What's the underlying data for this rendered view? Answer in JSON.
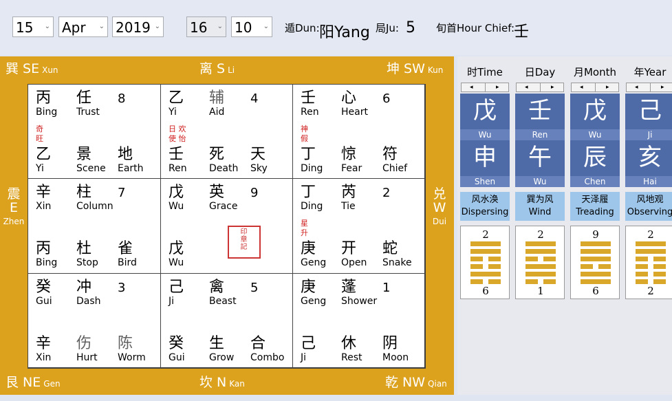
{
  "controls": {
    "day": "15",
    "month": "Apr",
    "year": "2019",
    "hour": "16",
    "minute": "10"
  },
  "info": {
    "dun_label": "遁Dun:",
    "dun_value": "阳Yang",
    "ju_label": "局Ju:",
    "ju_value": "5",
    "chief_label": "旬首Hour Chief:",
    "chief_value": "壬"
  },
  "directions": {
    "se": "巽 SE",
    "se_py": "Xun",
    "s": "离 S",
    "s_py": "Li",
    "sw": "坤 SW",
    "sw_py": "Kun",
    "e_zh": "震",
    "e": "E",
    "e_py": "Zhen",
    "w_zh": "兑",
    "w": "W",
    "w_py": "Dui",
    "ne": "艮 NE",
    "ne_py": "Gen",
    "n": "坎 N",
    "n_py": "Kan",
    "nw": "乾 NW",
    "nw_py": "Qian"
  },
  "palaces": [
    {
      "top_stem": "丙",
      "top_stem_en": "Bing",
      "star": "任",
      "star_en": "Trust",
      "num": "8",
      "red1": "奇",
      "red2": "旺",
      "bot_stem": "乙",
      "bot_stem_en": "Yi",
      "door": "景",
      "door_en": "Scene",
      "deity": "地",
      "deity_en": "Earth"
    },
    {
      "top_stem": "乙",
      "top_stem_en": "Yi",
      "star": "辅",
      "star_en": "Aid",
      "num": "4",
      "red1": "日 欢",
      "red2": "使 怡",
      "bot_stem": "壬",
      "bot_stem_en": "Ren",
      "door": "死",
      "door_en": "Death",
      "deity": "天",
      "deity_en": "Sky"
    },
    {
      "top_stem": "壬",
      "top_stem_en": "Ren",
      "star": "心",
      "star_en": "Heart",
      "num": "6",
      "red1": "神",
      "red2": "假",
      "bot_stem": "丁",
      "bot_stem_en": "Ding",
      "door": "惊",
      "door_en": "Fear",
      "deity": "符",
      "deity_en": "Chief"
    },
    {
      "top_stem": "辛",
      "top_stem_en": "Xin",
      "star": "柱",
      "star_en": "Column",
      "num": "7",
      "red1": "",
      "red2": "",
      "bot_stem": "丙",
      "bot_stem_en": "Bing",
      "door": "杜",
      "door_en": "Stop",
      "deity": "雀",
      "deity_en": "Bird"
    },
    {
      "top_stem": "戊",
      "top_stem_en": "Wu",
      "star": "英",
      "star_en": "Grace",
      "num": "9",
      "red1": "",
      "red2": "",
      "bot_stem": "戊",
      "bot_stem_en": "Wu",
      "door": "",
      "door_en": "",
      "deity": "",
      "deity_en": ""
    },
    {
      "top_stem": "丁",
      "top_stem_en": "Ding",
      "star": "芮",
      "star_en": "Tie",
      "num": "2",
      "red1": "星",
      "red2": "升",
      "bot_stem": "庚",
      "bot_stem_en": "Geng",
      "door": "开",
      "door_en": "Open",
      "deity": "蛇",
      "deity_en": "Snake"
    },
    {
      "top_stem": "癸",
      "top_stem_en": "Gui",
      "star": "冲",
      "star_en": "Dash",
      "num": "3",
      "red1": "",
      "red2": "",
      "bot_stem": "辛",
      "bot_stem_en": "Xin",
      "door": "伤",
      "door_en": "Hurt",
      "deity": "陈",
      "deity_en": "Worm"
    },
    {
      "top_stem": "己",
      "top_stem_en": "Ji",
      "star": "禽",
      "star_en": "Beast",
      "num": "5",
      "red1": "",
      "red2": "",
      "bot_stem": "癸",
      "bot_stem_en": "Gui",
      "door": "生",
      "door_en": "Grow",
      "deity": "合",
      "deity_en": "Combo"
    },
    {
      "top_stem": "庚",
      "top_stem_en": "Geng",
      "star": "蓬",
      "star_en": "Shower",
      "num": "1",
      "red1": "",
      "red2": "",
      "bot_stem": "己",
      "bot_stem_en": "Ji",
      "door": "休",
      "door_en": "Rest",
      "deity": "阴",
      "deity_en": "Moon"
    }
  ],
  "seal_text": "",
  "pillars": [
    {
      "header": "时Time",
      "stem": "戊",
      "stem_py": "Wu",
      "branch": "申",
      "branch_py": "Shen",
      "hex_zh": "风水涣",
      "hex_en": "Dispersing",
      "top_num": "2",
      "bot_num": "6",
      "lines": [
        1,
        1,
        0,
        0,
        1,
        0
      ]
    },
    {
      "header": "日Day",
      "stem": "壬",
      "stem_py": "Ren",
      "branch": "午",
      "branch_py": "Wu",
      "hex_zh": "巽为风",
      "hex_en": "Wind",
      "top_num": "2",
      "bot_num": "1",
      "lines": [
        1,
        1,
        0,
        1,
        1,
        0
      ]
    },
    {
      "header": "月Month",
      "stem": "戊",
      "stem_py": "Wu",
      "branch": "辰",
      "branch_py": "Chen",
      "hex_zh": "天泽履",
      "hex_en": "Treading",
      "top_num": "9",
      "bot_num": "6",
      "lines": [
        1,
        1,
        1,
        0,
        1,
        1
      ]
    },
    {
      "header": "年Year",
      "stem": "己",
      "stem_py": "Ji",
      "branch": "亥",
      "branch_py": "Hai",
      "hex_zh": "风地观",
      "hex_en": "Observing",
      "top_num": "2",
      "bot_num": "2",
      "lines": [
        1,
        1,
        0,
        0,
        0,
        0
      ]
    }
  ]
}
